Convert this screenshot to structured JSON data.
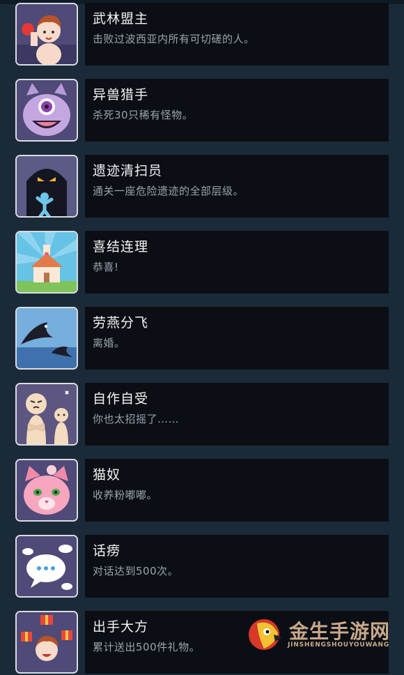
{
  "achievements": [
    {
      "title": "武林盟主",
      "desc": "击败过波西亚内所有可切磋的人。",
      "icon": "boxer-icon"
    },
    {
      "title": "异兽猎手",
      "desc": "杀死30只稀有怪物。",
      "icon": "one-eyed-monster-icon"
    },
    {
      "title": "遗迹清扫员",
      "desc": "通关一座危险遗迹的全部层级。",
      "icon": "ruins-shadow-icon"
    },
    {
      "title": "喜结连理",
      "desc": "恭喜!",
      "icon": "chapel-icon"
    },
    {
      "title": "劳燕分飞",
      "desc": "离婚。",
      "icon": "swallows-icon"
    },
    {
      "title": "自作自受",
      "desc": "你也太招摇了……",
      "icon": "angry-figures-icon"
    },
    {
      "title": "猫奴",
      "desc": "收养粉嘟嘟。",
      "icon": "pink-cat-icon"
    },
    {
      "title": "话痨",
      "desc": "对话达到500次。",
      "icon": "speech-bubbles-icon"
    },
    {
      "title": "出手大方",
      "desc": "累计送出500件礼物。",
      "icon": "gifts-icon"
    }
  ],
  "watermark": {
    "cn": "金生手游网",
    "en": "JINSHENGSHOUYOUWANG"
  },
  "colors": {
    "page_bg": "#1b2a38",
    "panel_bg": "#0b0f15",
    "title": "#f2f2f2",
    "desc": "#9aa3ad",
    "watermark": "#c9a98a"
  }
}
